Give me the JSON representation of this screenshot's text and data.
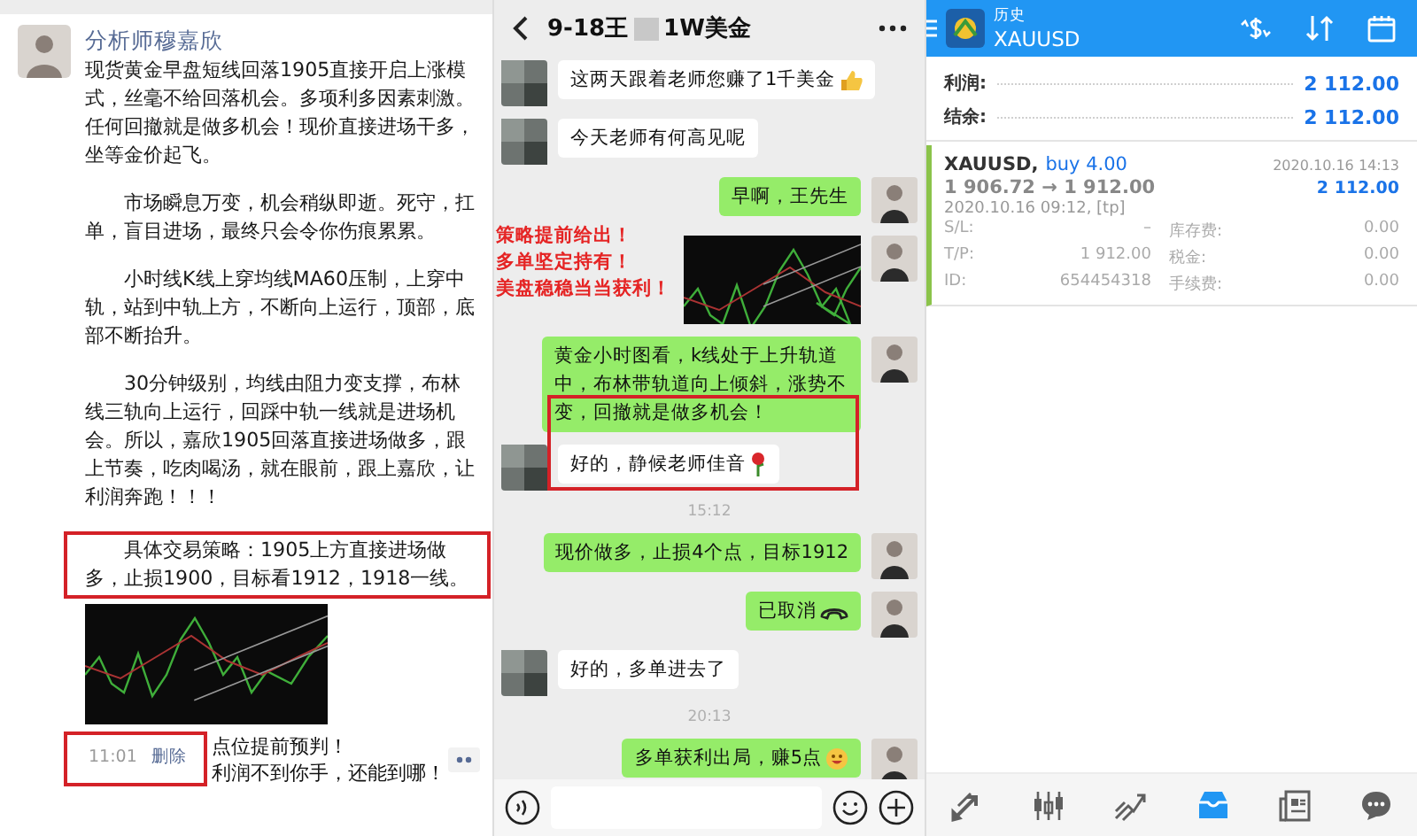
{
  "moments_post": {
    "author": "分析师穆嘉欣",
    "paragraphs": [
      {
        "text": "现货黄金早盘短线回落1905直接开启上涨模式，丝毫不给回落机会。多项利多因素刺激。任何回撤就是做多机会！现价直接进场干多，坐等金价起飞。",
        "highlighted": false
      },
      {
        "text": "　　市场瞬息万变，机会稍纵即逝。死守，扛单，盲目进场，最终只会令你伤痕累累。",
        "highlighted": false
      },
      {
        "text": "　　小时线K线上穿均线MA60压制，上穿中轨，站到中轨上方，不断向上运行，顶部，底部不断抬升。",
        "highlighted": false
      },
      {
        "text": "　　30分钟级别，均线由阻力变支撑，布林线三轨向上运行，回踩中轨一线就是进场机会。所以，嘉欣1905回落直接进场做多，跟上节奏，吃肉喝汤，就在眼前，跟上嘉欣，让利润奔跑！！！",
        "highlighted": false
      },
      {
        "text": "　　具体交易策略：1905上方直接进场做多，止损1900，目标看1912，1918一线。",
        "highlighted": true
      }
    ],
    "time": "11:01",
    "delete_link": "删除",
    "annotation": [
      "点位提前预判！",
      "利润不到你手，还能到哪！"
    ]
  },
  "chat": {
    "title_start": "9-18王",
    "title_end": "1W美金",
    "messages": [
      {
        "kind": "received",
        "text": "这两天跟着老师您赚了1千美金",
        "sticker": {
          "kind": "thumbs_up"
        }
      },
      {
        "kind": "received",
        "text": "今天老师有何高见呢"
      },
      {
        "kind": "sent",
        "text": "早啊，王先生"
      },
      {
        "kind": "image"
      },
      {
        "kind": "sent",
        "text": "黄金小时图看，k线处于上升轨道中，布林带轨道向上倾斜，涨势不变，回撤就是做多机会！"
      },
      {
        "kind": "received",
        "text": "好的，静候老师佳音",
        "sticker": {
          "kind": "rose"
        }
      },
      {
        "kind": "time",
        "text": "15:12"
      },
      {
        "kind": "sent",
        "text": "现价做多，止损4个点，目标1912"
      },
      {
        "kind": "call",
        "text": "已取消"
      },
      {
        "kind": "received",
        "text": "好的，多单进去了"
      },
      {
        "kind": "time",
        "text": "20:13"
      },
      {
        "kind": "sent",
        "text": "多单获利出局，赚5点",
        "sticker": {
          "kind": "smile"
        }
      }
    ],
    "annotation": [
      "策略提前给出！",
      "多单坚定持有！",
      "美盘稳稳当当获利！"
    ]
  },
  "history": {
    "subtitle": "历史",
    "symbol": "XAUUSD",
    "summary": [
      {
        "label": "利润:",
        "value": "2 112.00"
      },
      {
        "label": "结余:",
        "value": "2 112.00"
      }
    ],
    "deal": {
      "symbol": "XAUUSD,",
      "type": "buy 4.00",
      "close_time": "2020.10.16 14:13",
      "prices": "1 906.72 → 1 912.00",
      "profit": "2 112.00",
      "open_time": "2020.10.16 09:12, [tp]",
      "fields": [
        {
          "label": "S/L:",
          "value": "–"
        },
        {
          "label": "库存费:",
          "value": "0.00"
        },
        {
          "label": "T/P:",
          "value": "1 912.00"
        },
        {
          "label": "税金:",
          "value": "0.00"
        },
        {
          "label": "ID:",
          "value": "654454318"
        },
        {
          "label": "手续费:",
          "value": "0.00"
        }
      ]
    },
    "nav": [
      {
        "kind": "trade",
        "selected": false
      },
      {
        "kind": "quotes",
        "selected": false
      },
      {
        "kind": "chart",
        "selected": false
      },
      {
        "kind": "history",
        "selected": true
      },
      {
        "kind": "news",
        "selected": false
      },
      {
        "kind": "chat",
        "selected": false
      }
    ]
  }
}
